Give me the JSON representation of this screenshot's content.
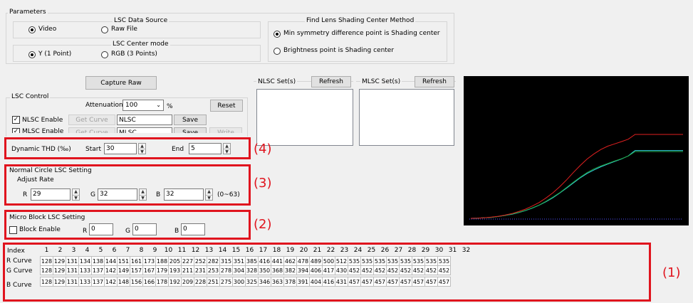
{
  "parameters": {
    "legend": "Parameters",
    "lsc_source": {
      "legend": "LSC Data Source",
      "video": "Video",
      "raw_file": "Raw File",
      "selected": "Video"
    },
    "lsc_center": {
      "legend": "LSC Center mode",
      "y_mode": "Y (1 Point)",
      "rgb_mode": "RGB (3 Points)",
      "selected": "Y (1 Point)"
    },
    "find_center": {
      "legend": "Find Lens Shading Center Method",
      "opt_min": "Min symmetry difference point is Shading center",
      "opt_bright": "Brightness point is Shading center",
      "selected": "min"
    }
  },
  "capture_raw": "Capture Raw",
  "lsc_control": {
    "legend": "LSC Control",
    "attenuation_label": "Attenuation",
    "attenuation_value": "100",
    "percent": "%",
    "reset": "Reset",
    "nlsc_enable": "NLSC Enable",
    "mlsc_enable": "MLSC Enable",
    "get_curve": "Get Curve",
    "nlsc_name": "NLSC",
    "mlsc_name": "MLSC",
    "save": "Save",
    "write": "Write"
  },
  "nlsc_set": {
    "legend": "NLSC Set(s)",
    "refresh": "Refresh"
  },
  "mlsc_set": {
    "legend": "MLSC Set(s)",
    "refresh": "Refresh"
  },
  "dynamic_thd": {
    "label": "Dynamic THD (‰)",
    "start_label": "Start",
    "start_value": "30",
    "end_label": "End",
    "end_value": "5"
  },
  "normal_circle": {
    "legend": "Normal Circle LSC Setting",
    "adjust_rate": "Adjust Rate",
    "r_label": "R",
    "r_value": "29",
    "g_label": "G",
    "g_value": "32",
    "b_label": "B",
    "b_value": "32",
    "range": "(0~63)"
  },
  "micro_block": {
    "legend": "Micro Block LSC Setting",
    "block_enable": "Block Enable",
    "r_label": "R",
    "r_value": "0",
    "g_label": "G",
    "g_value": "0",
    "b_label": "B",
    "b_value": "0"
  },
  "annotations": {
    "a1": "(1)",
    "a2": "(2)",
    "a3": "(3)",
    "a4": "(4)"
  },
  "colors": {
    "accent_red": "#e0141e",
    "r_curve": "#e02020",
    "g_curve": "#20a040",
    "b_curve": "#30d0e0"
  },
  "curve_table": {
    "index_label": "Index",
    "indices": [
      "1",
      "2",
      "3",
      "4",
      "5",
      "6",
      "7",
      "8",
      "9",
      "10",
      "11",
      "12",
      "13",
      "14",
      "15",
      "16",
      "17",
      "18",
      "19",
      "20",
      "21",
      "22",
      "23",
      "24",
      "25",
      "26",
      "27",
      "28",
      "29",
      "30",
      "31",
      "32"
    ],
    "rows": [
      {
        "label": "R Curve",
        "values": [
          128,
          129,
          131,
          134,
          138,
          144,
          151,
          161,
          173,
          188,
          205,
          227,
          252,
          282,
          315,
          351,
          385,
          416,
          441,
          462,
          478,
          489,
          500,
          512,
          535,
          535,
          535,
          535,
          535,
          535,
          535,
          535
        ]
      },
      {
        "label": "G Curve",
        "values": [
          128,
          129,
          131,
          133,
          137,
          142,
          149,
          157,
          167,
          179,
          193,
          211,
          231,
          253,
          278,
          304,
          328,
          350,
          368,
          382,
          394,
          406,
          417,
          430,
          452,
          452,
          452,
          452,
          452,
          452,
          452,
          452
        ]
      },
      {
        "label": "B Curve",
        "values": [
          128,
          129,
          131,
          133,
          137,
          142,
          148,
          156,
          166,
          178,
          192,
          209,
          228,
          251,
          275,
          300,
          325,
          346,
          363,
          378,
          391,
          404,
          416,
          431,
          457,
          457,
          457,
          457,
          457,
          457,
          457,
          457
        ]
      }
    ]
  }
}
